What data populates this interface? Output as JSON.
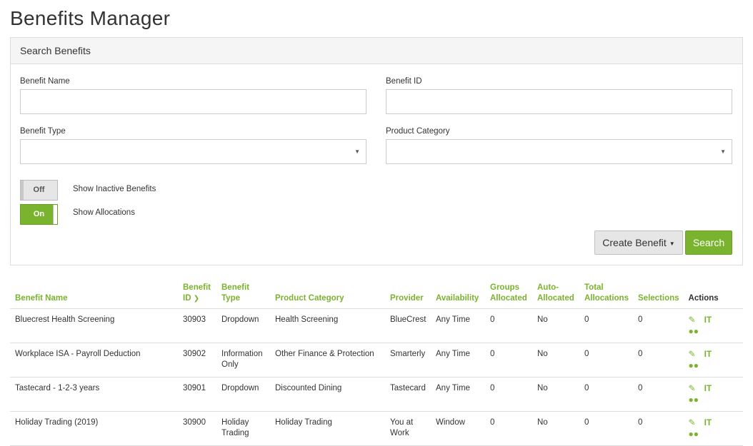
{
  "page": {
    "title": "Benefits Manager"
  },
  "search_panel": {
    "heading": "Search Benefits",
    "benefit_name": {
      "label": "Benefit Name",
      "value": "",
      "placeholder": ""
    },
    "benefit_id": {
      "label": "Benefit ID",
      "value": "",
      "placeholder": ""
    },
    "benefit_type": {
      "label": "Benefit Type",
      "selected": ""
    },
    "product_category": {
      "label": "Product Category",
      "selected": ""
    },
    "toggles": {
      "inactive": {
        "state": "Off",
        "label": "Show Inactive Benefits"
      },
      "allocations": {
        "state": "On",
        "label": "Show Allocations"
      }
    },
    "buttons": {
      "create": "Create Benefit",
      "search": "Search"
    }
  },
  "icons": {
    "caret": "caret-down-icon",
    "sort": "chevron-down-icon",
    "edit": "pencil-icon",
    "text": "text-format-icon",
    "groups": "users-group-icon"
  },
  "colors": {
    "accent": "#7ab32e",
    "border": "#dddddd",
    "panel_heading_bg": "#f5f5f5"
  },
  "table": {
    "headers": {
      "name": "Benefit Name",
      "id_1": "Benefit",
      "id_2": "ID",
      "type_1": "Benefit",
      "type_2": "Type",
      "category": "Product Category",
      "provider": "Provider",
      "availability": "Availability",
      "groups_1": "Groups",
      "groups_2": "Allocated",
      "auto_1": "Auto-",
      "auto_2": "Allocated",
      "total_1": "Total",
      "total_2": "Allocations",
      "selections": "Selections",
      "actions": "Actions"
    },
    "rows": [
      {
        "name": "Bluecrest Health Screening",
        "id": "30903",
        "type": "Dropdown",
        "category": "Health Screening",
        "provider": "BlueCrest",
        "availability": "Any Time",
        "groups": "0",
        "auto": "No",
        "total": "0",
        "selections": "0"
      },
      {
        "name": "Workplace ISA - Payroll Deduction",
        "id": "30902",
        "type": "Information Only",
        "category": "Other Finance & Protection",
        "provider": "Smarterly",
        "availability": "Any Time",
        "groups": "0",
        "auto": "No",
        "total": "0",
        "selections": "0"
      },
      {
        "name": "Tastecard - 1-2-3 years",
        "id": "30901",
        "type": "Dropdown",
        "category": "Discounted Dining",
        "provider": "Tastecard",
        "availability": "Any Time",
        "groups": "0",
        "auto": "No",
        "total": "0",
        "selections": "0"
      },
      {
        "name": "Holiday Trading (2019)",
        "id": "30900",
        "type": "Holiday Trading",
        "category": "Holiday Trading",
        "provider": "You at Work",
        "availability": "Window",
        "groups": "0",
        "auto": "No",
        "total": "0",
        "selections": "0"
      }
    ]
  }
}
